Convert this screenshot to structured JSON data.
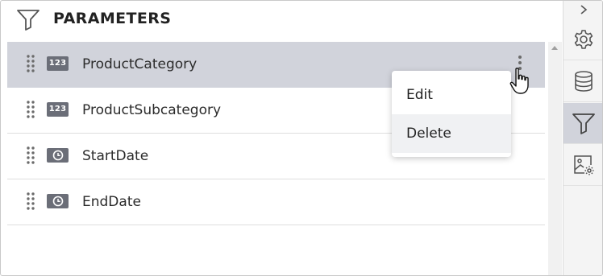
{
  "header": {
    "title": "PARAMETERS",
    "icon": "filter-icon"
  },
  "parameters": [
    {
      "name": "ProductCategory",
      "type_badge": "123",
      "type_icon": "number-type-icon",
      "selected": true
    },
    {
      "name": "ProductSubcategory",
      "type_badge": "123",
      "type_icon": "number-type-icon",
      "selected": false
    },
    {
      "name": "StartDate",
      "type_badge": "",
      "type_icon": "datetime-type-icon",
      "selected": false
    },
    {
      "name": "EndDate",
      "type_badge": "",
      "type_icon": "datetime-type-icon",
      "selected": false
    }
  ],
  "context_menu": {
    "items": [
      {
        "label": "Edit"
      },
      {
        "label": "Delete"
      }
    ],
    "hovered": "Delete"
  },
  "rail": {
    "buttons": [
      {
        "icon": "chevron-right-icon"
      },
      {
        "icon": "gear-icon"
      },
      {
        "icon": "database-icon"
      },
      {
        "icon": "filter-icon",
        "active": true
      },
      {
        "icon": "image-settings-icon"
      }
    ]
  },
  "colors": {
    "selected_row": "#d1d3db",
    "badge": "#6b6e78",
    "rail_bg": "#f4f4f4"
  }
}
